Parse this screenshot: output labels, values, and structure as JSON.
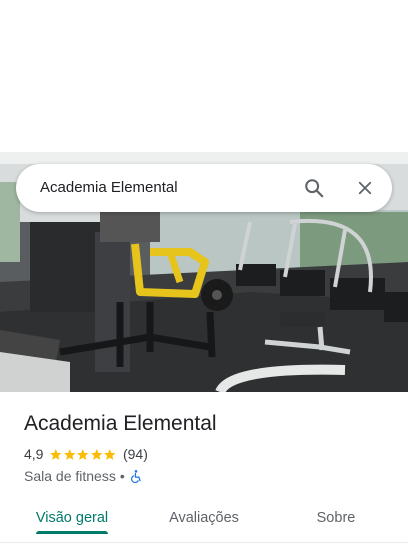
{
  "search": {
    "query": "Academia Elemental",
    "search_icon": "search-icon",
    "close_icon": "close-icon"
  },
  "photo": {
    "subject": "gym-interior-photo"
  },
  "place": {
    "title": "Academia Elemental",
    "rating": "4,9",
    "stars": 5,
    "review_count": "(94)",
    "category": "Sala de fitness",
    "separator": "•",
    "accessibility_icon": "wheelchair-icon"
  },
  "tabs": [
    {
      "label": "Visão geral",
      "active": true
    },
    {
      "label": "Avaliações",
      "active": false
    },
    {
      "label": "Sobre",
      "active": false
    }
  ],
  "colors": {
    "accent": "#00796b",
    "star": "#fbbc04",
    "a11y": "#1a73e8"
  }
}
